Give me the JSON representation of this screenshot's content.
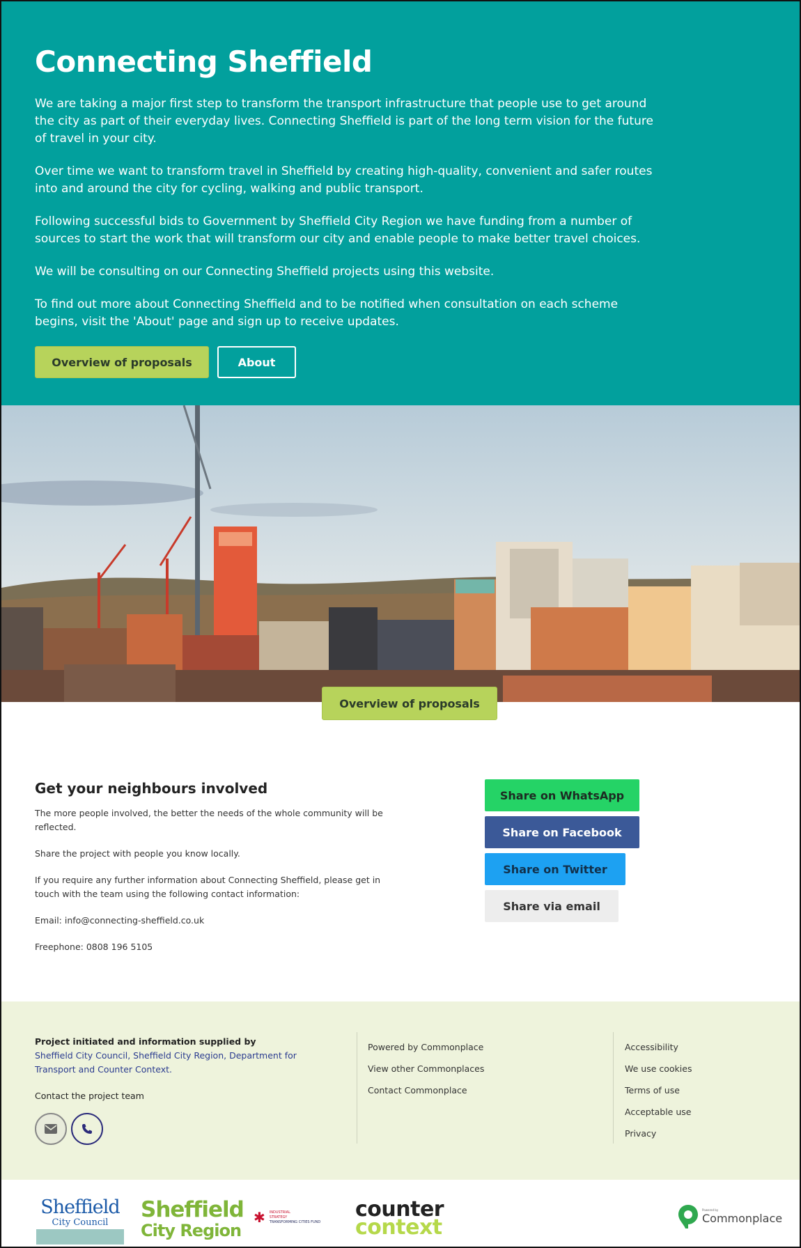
{
  "hero": {
    "title": "Connecting Sheffield",
    "paragraphs": [
      "We are taking a major first step to transform the transport infrastructure that people use to get around the city as part of their everyday lives. Connecting Sheffield is part of the long term vision for the future of travel in your city.",
      "Over time we want to transform travel in Sheffield by creating high-quality, convenient and safer routes into and around the city for cycling, walking and public transport.",
      "Following successful bids to Government by Sheffield City Region we have funding from a number of sources to start the work that will transform our city and enable people to make better travel choices.",
      "We will be consulting on our Connecting Sheffield projects using this website.",
      "To find out more about Connecting Sheffield and to be notified when consultation on each scheme begins, visit the 'About' page and sign up to receive updates."
    ],
    "primary_button": "Overview of proposals",
    "secondary_button": "About",
    "background_color": "#02a09d"
  },
  "image_section": {
    "button": "Overview of proposals"
  },
  "involve": {
    "heading": "Get your neighbours involved",
    "paragraphs": [
      "The more people involved, the better the needs of the whole community will be reflected.",
      "Share the project with people you know locally.",
      "If you require any further information about Connecting Sheffield, please get in touch with the team using the following contact information:",
      "Email: info@connecting-sheffield.co.uk",
      "Freephone: 0808 196 5105"
    ]
  },
  "share": {
    "whatsapp": "Share on WhatsApp",
    "facebook": "Share on Facebook",
    "twitter": "Share on Twitter",
    "email": "Share via email",
    "colors": {
      "whatsapp": "#25d366",
      "facebook": "#3b5998",
      "twitter": "#1da1f2",
      "email": "#ededed"
    }
  },
  "footer": {
    "initiated_label": "Project initiated and information supplied by",
    "initiated_orgs": "Sheffield City Council, Sheffield City Region, Department for Transport and Counter Context.",
    "contact_label": "Contact the project team",
    "icons": [
      "mail-icon",
      "phone-icon"
    ],
    "links_middle": [
      "Powered by Commonplace",
      "View other Commonplaces",
      "Contact Commonplace"
    ],
    "links_right": [
      "Accessibility",
      "We use cookies",
      "Terms of use",
      "Acceptable use",
      "Privacy"
    ],
    "background_color": "#eef3dc"
  },
  "logos": {
    "sheffield_city_council": [
      "Sheffield",
      "City Council"
    ],
    "sheffield_city_region": [
      "Sheffield",
      "City Region"
    ],
    "industrial_strategy": [
      "INDUSTRIAL",
      "STRATEGY",
      "TRANSFORMING CITIES FUND"
    ],
    "counter_context": [
      "counter",
      "context"
    ],
    "commonplace": {
      "powered_by": "Powered by",
      "name": "Commonplace"
    }
  }
}
